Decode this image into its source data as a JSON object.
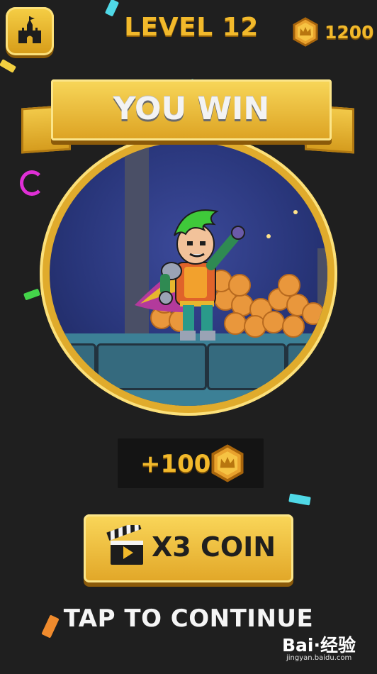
{
  "header": {
    "level_title": "LEVEL 12",
    "coin_total": "1200",
    "home_icon": "castle-icon"
  },
  "banner": {
    "text": "YOU WIN"
  },
  "reward": {
    "amount": "+100",
    "icon": "crown-coin-icon"
  },
  "bonus_button": {
    "label": "X3 COIN",
    "icon": "clapperboard-icon"
  },
  "continue": {
    "text": "TAP TO CONTINUE"
  },
  "watermark": {
    "brand": "Bai·经验",
    "url": "jingyan.baidu.com"
  },
  "colors": {
    "background": "#1f1f1f",
    "gold": "#f2b92b",
    "banner_text": "#f3f3f3"
  }
}
